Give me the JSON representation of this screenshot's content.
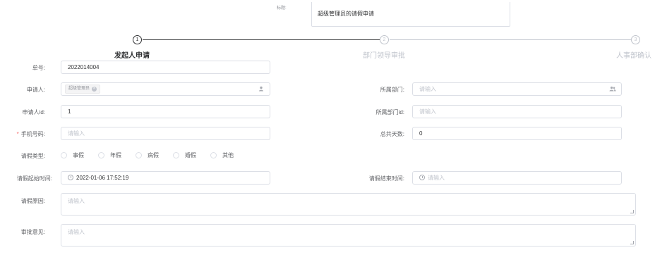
{
  "header": {
    "title_label": "标题:",
    "title_value": "超级管理员的请假申请"
  },
  "steps": [
    {
      "num": "1",
      "title": "发起人申请",
      "status": "active"
    },
    {
      "num": "2",
      "title": "部门领导审批",
      "status": "wait"
    },
    {
      "num": "3",
      "title": "人事部确认",
      "status": "wait"
    }
  ],
  "form": {
    "order_no": {
      "label": "单号:",
      "value": "2022014004"
    },
    "applicant": {
      "label": "申请人:",
      "tag": "超级管理员"
    },
    "department": {
      "label": "所属部门:",
      "placeholder": "请输入"
    },
    "applicant_id": {
      "label": "申请人id:",
      "value": "1"
    },
    "department_id": {
      "label": "所属部门id:",
      "placeholder": "请输入"
    },
    "phone": {
      "label": "手机号码:",
      "placeholder": "请输入",
      "required_mark": "*"
    },
    "total_days": {
      "label": "总共天数:",
      "value": "0"
    },
    "leave_type": {
      "label": "请假类型:",
      "options": [
        "事假",
        "年假",
        "病假",
        "婚假",
        "其他"
      ]
    },
    "start_time": {
      "label": "请假起始时间:",
      "value": "2022-01-06 17:52:19"
    },
    "end_time": {
      "label": "请假结束时间:",
      "placeholder": "请输入"
    },
    "reason": {
      "label": "请假原因:",
      "placeholder": "请输入"
    },
    "opinion": {
      "label": "审批意见:",
      "placeholder": "请输入"
    }
  }
}
